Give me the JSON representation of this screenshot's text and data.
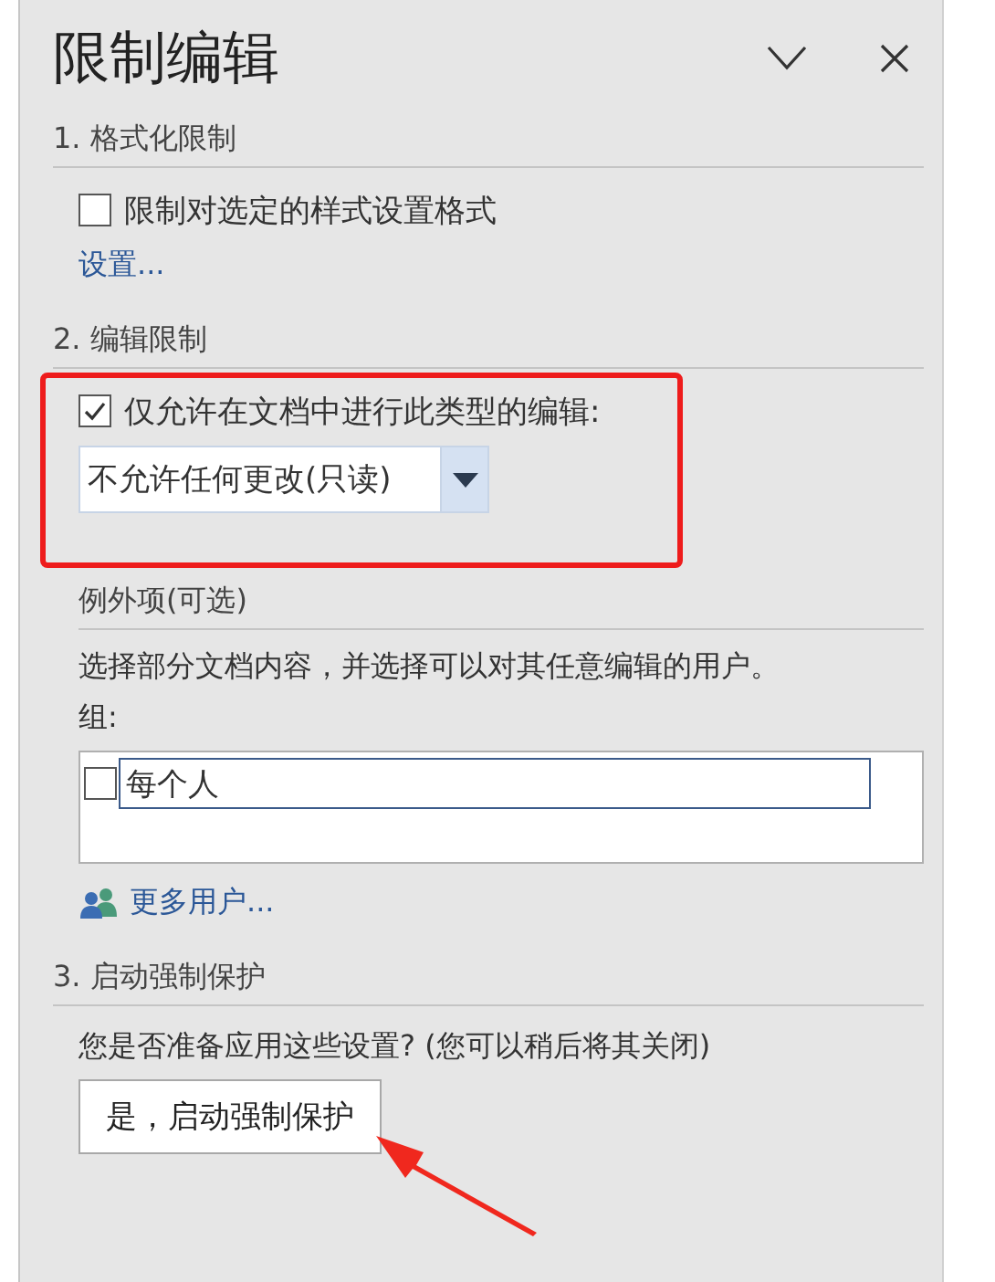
{
  "panel": {
    "title": "限制编辑",
    "sections": [
      {
        "heading": "1. 格式化限制",
        "highlighted": false,
        "items": [
          {
            "kind": "checkbox",
            "label": "限制对选定的样式设置格式",
            "checked": false
          },
          {
            "kind": "link",
            "label": "设置..."
          }
        ]
      },
      {
        "heading": "2. 编辑限制",
        "highlighted": true,
        "items": [
          {
            "kind": "checkbox",
            "label": "仅允许在文档中进行此类型的编辑:",
            "checked": true
          },
          {
            "kind": "dropdown",
            "value": "不允许任何更改(只读)"
          },
          {
            "kind": "subheading",
            "label": "例外项(可选)"
          },
          {
            "kind": "text",
            "label": "选择部分文档内容，并选择可以对其任意编辑的用户。"
          },
          {
            "kind": "text",
            "label": "组:"
          },
          {
            "kind": "listbox",
            "entries": [
              {
                "label": "每个人",
                "checked": false
              }
            ]
          },
          {
            "kind": "users-link",
            "label": "更多用户..."
          }
        ]
      },
      {
        "heading": "3. 启动强制保护",
        "highlighted": false,
        "items": [
          {
            "kind": "text",
            "label": "您是否准备应用这些设置? (您可以稍后将其关闭)"
          },
          {
            "kind": "button",
            "label": "是，启动强制保护",
            "pointed_at": true
          }
        ]
      }
    ]
  }
}
